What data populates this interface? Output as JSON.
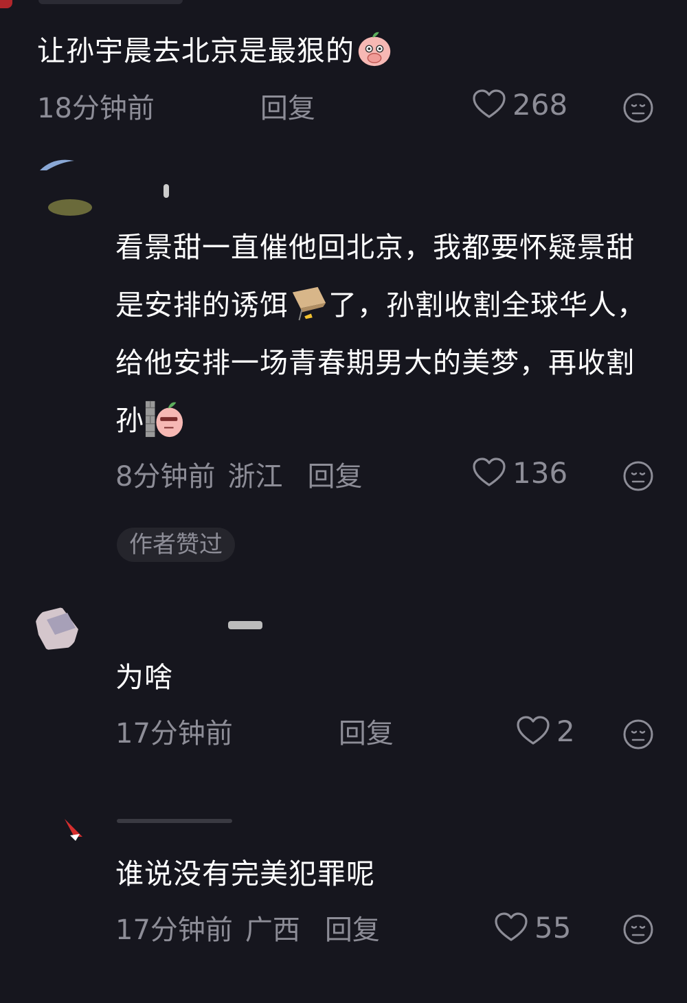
{
  "comments": [
    {
      "text": "让孙宇晨去北京是最狠的",
      "emoji": "peach-covering-mouth-emoji",
      "time": "18分钟前",
      "region": "",
      "reply_label": "回复",
      "likes": "268"
    },
    {
      "text": "看景甜一直催他回北京，我都要怀疑景甜是安排的诱饵",
      "text_after_emoji": "了，孙割收割全球华人，给他安排一场青春期男大的美梦，再收割孙",
      "emoji_inline": "trap-box-emoji",
      "emoji_end": "peach-peeking-wall-emoji",
      "time": "8分钟前",
      "region": "浙江",
      "reply_label": "回复",
      "likes": "136",
      "badge": "作者赞过"
    },
    {
      "text": "为啥",
      "time": "17分钟前",
      "region": "",
      "reply_label": "回复",
      "likes": "2"
    },
    {
      "text": "谁说没有完美犯罪呢",
      "time": "17分钟前",
      "region": "广西",
      "reply_label": "回复",
      "likes": "55"
    }
  ],
  "colors": {
    "background": "#16161e",
    "text": "#ffffff",
    "meta": "#8d8d97"
  }
}
